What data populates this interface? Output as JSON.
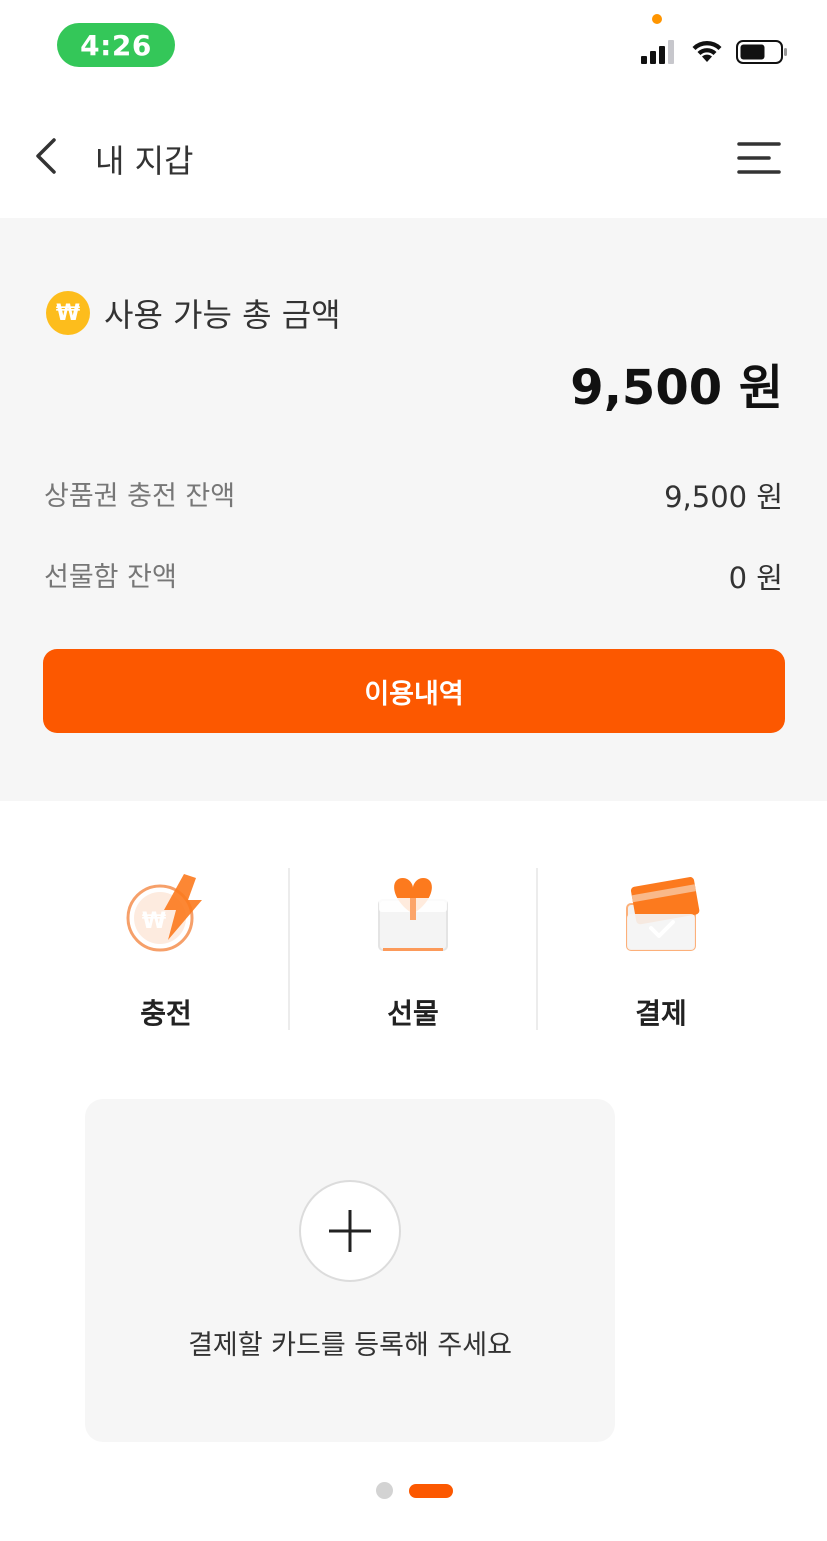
{
  "status_bar": {
    "time": "4:26"
  },
  "header": {
    "title": "내 지갑",
    "back_icon": "chevron-left-icon",
    "menu_icon": "hamburger-menu-icon"
  },
  "summary": {
    "total_label": "사용 가능 총 금액",
    "total_icon_glyph": "₩",
    "total_amount": "9,500 원",
    "rows": [
      {
        "label": "상품권 충전 잔액",
        "value": "9,500 원"
      },
      {
        "label": "선물함 잔액",
        "value": "0 원"
      }
    ],
    "history_button": "이용내역"
  },
  "actions": [
    {
      "label": "충전",
      "icon": "charge-coin-icon"
    },
    {
      "label": "선물",
      "icon": "gift-box-icon"
    },
    {
      "label": "결제",
      "icon": "payment-card-icon"
    }
  ],
  "card_register": {
    "text": "결제할 카드를 등록해 주세요",
    "icon": "plus-icon"
  },
  "pagination": {
    "total": 2,
    "active_index": 1
  },
  "colors": {
    "accent": "#fc5800",
    "coin": "#fdbd1c",
    "status_pill": "#34c759",
    "panel_bg": "#f6f6f6"
  }
}
